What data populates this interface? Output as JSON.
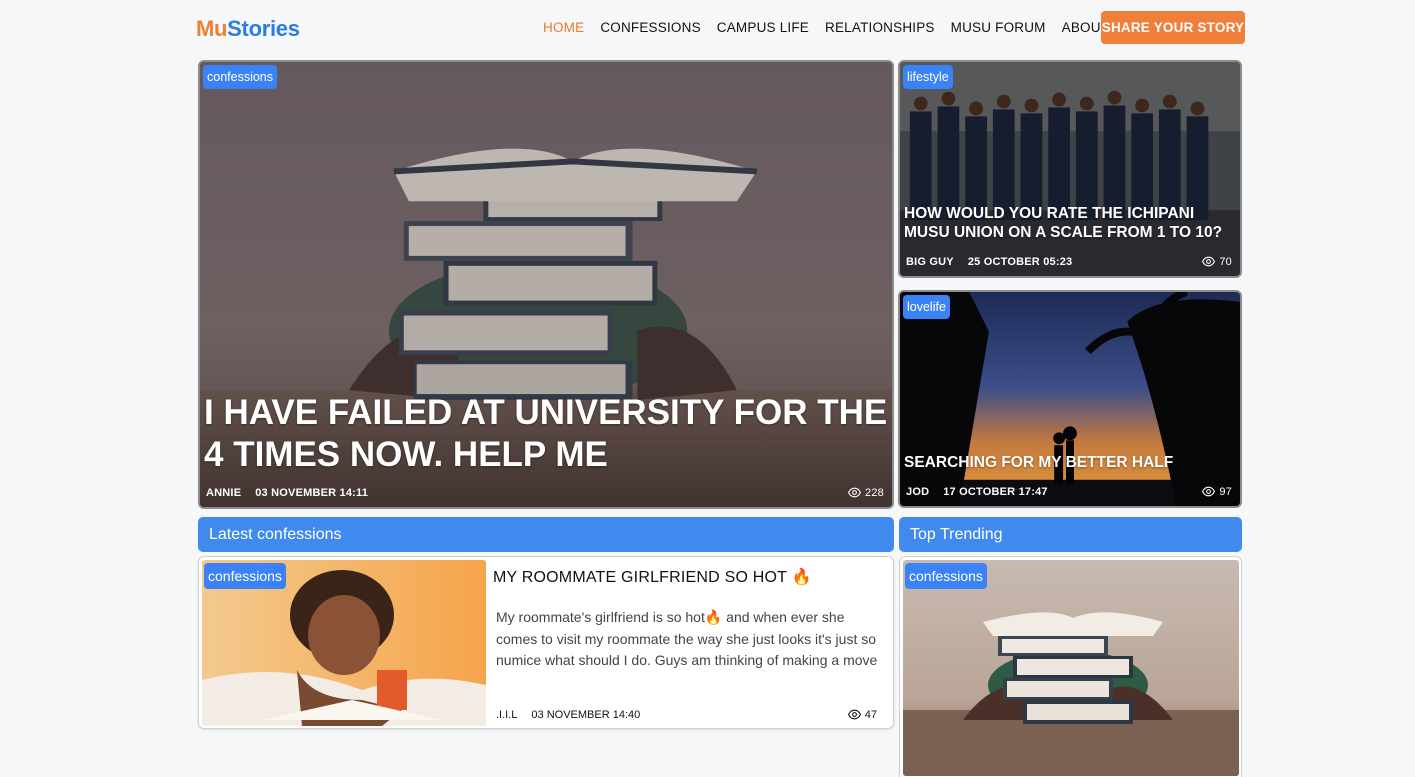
{
  "brand": {
    "part1": "Mu",
    "part2": "Stories"
  },
  "nav": {
    "items": [
      {
        "label": "HOME",
        "active": true
      },
      {
        "label": "CONFESSIONS",
        "active": false
      },
      {
        "label": "CAMPUS LIFE",
        "active": false
      },
      {
        "label": "RELATIONSHIPS",
        "active": false
      },
      {
        "label": "MUSU FORUM",
        "active": false
      },
      {
        "label": "ABOUT US",
        "active": false
      }
    ],
    "cta": "SHARE YOUR STORY"
  },
  "featured": [
    {
      "category": "confessions",
      "title": "I HAVE FAILED AT UNIVERSITY FOR THE 4 TIMES NOW. HELP ME",
      "author": "ANNIE",
      "date": "03 NOVEMBER 14:11",
      "views": "228"
    },
    {
      "category": "lifestyle",
      "title": "HOW WOULD YOU RATE THE ICHIPANI MUSU UNION ON A SCALE FROM 1 TO 10?",
      "author": "BIG GUY",
      "date": "25 OCTOBER 05:23",
      "views": "70"
    },
    {
      "category": "lovelife",
      "title": "SEARCHING FOR MY BETTER HALF",
      "author": "JOD",
      "date": "17 OCTOBER 17:47",
      "views": "97"
    }
  ],
  "sections": {
    "latest": "Latest confessions",
    "top": "Top Trending"
  },
  "latest": {
    "category": "confessions",
    "title": "MY ROOMMATE GIRLFRIEND SO HOT 🔥",
    "excerpt": "My roommate's girlfriend is so hot🔥 and when ever she comes to visit my roommate the way she just looks it's just so numice what should I do. Guys am thinking of making a move",
    "author": ".I.I.L",
    "date": "03 NOVEMBER 14:40",
    "views": "47"
  },
  "trending": {
    "category": "confessions"
  },
  "colors": {
    "accent_orange": "#f07f3c",
    "accent_blue": "#4089ee",
    "badge_blue": "#3b82f6"
  },
  "icons": {
    "views": "eye-icon"
  }
}
